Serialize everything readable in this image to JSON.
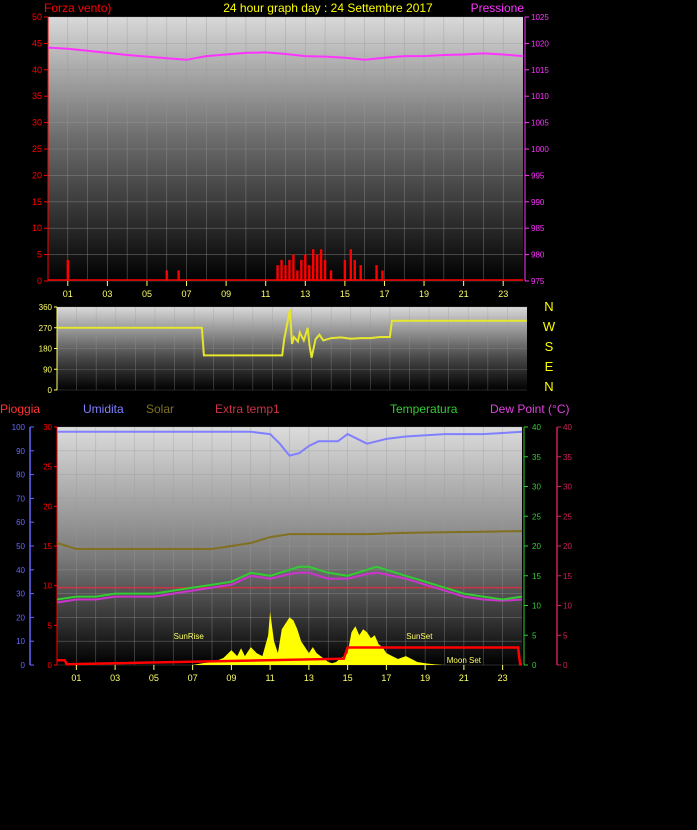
{
  "header": {
    "left_label": "Forza vento)",
    "center_title": "24 hour graph day : 24 Settembre 2017",
    "right_label": "Pressione"
  },
  "colors": {
    "wind": "#ff0000",
    "pressure": "#ff33ff",
    "direction": "#e6e62e",
    "humidity": "#8080ff",
    "solar": "#807020",
    "extra_temp": "#cc3344",
    "temperature": "#33cc33",
    "dew_point": "#cc33cc",
    "rain": "#ff0000",
    "solar_fill": "#ffff00",
    "pioggia_label": "#ff3333",
    "axis_blue": "#6666ff",
    "axis_green": "#33cc33",
    "axis_pink": "#cc2255",
    "tick_yellow": "#ffff66"
  },
  "x_ticks": [
    "01",
    "03",
    "05",
    "07",
    "09",
    "11",
    "13",
    "15",
    "17",
    "19",
    "21",
    "23"
  ],
  "chart_data": [
    {
      "type": "bar",
      "title": "24 hour graph day : 24 Settembre 2017",
      "ylabel": "Forza vento)",
      "y2label": "Pressione",
      "ylim": [
        0,
        50
      ],
      "y2lim": [
        975,
        1025
      ],
      "yticks": [
        0,
        5,
        10,
        15,
        20,
        25,
        30,
        35,
        40,
        45,
        50
      ],
      "y2ticks": [
        975,
        980,
        985,
        990,
        995,
        1000,
        1005,
        1010,
        1015,
        1020,
        1025
      ],
      "series": [
        {
          "name": "Forza vento)",
          "kind": "bar",
          "axis": "left",
          "x": [
            1.0,
            6.0,
            6.6,
            11.6,
            11.8,
            12.0,
            12.2,
            12.4,
            12.6,
            12.8,
            13.0,
            13.2,
            13.4,
            13.6,
            13.8,
            14.0,
            14.3,
            15.0,
            15.3,
            15.5,
            15.8,
            16.6,
            16.9
          ],
          "values": [
            4,
            2,
            2,
            3,
            4,
            3,
            4,
            5,
            2,
            4,
            5,
            3,
            6,
            5,
            6,
            4,
            2,
            4,
            6,
            4,
            3,
            3,
            2
          ]
        },
        {
          "name": "Pressione",
          "kind": "line",
          "axis": "right",
          "x": [
            0,
            1,
            2,
            3,
            4,
            5,
            6,
            7,
            8,
            9,
            10,
            11,
            12,
            13,
            14,
            15,
            16,
            17,
            18,
            19,
            20,
            21,
            22,
            23,
            24
          ],
          "values": [
            1019.2,
            1019.0,
            1018.6,
            1018.2,
            1017.8,
            1017.5,
            1017.2,
            1016.9,
            1017.6,
            1017.9,
            1018.2,
            1018.3,
            1018.0,
            1017.6,
            1017.5,
            1017.3,
            1016.9,
            1017.3,
            1017.6,
            1017.6,
            1017.8,
            1017.9,
            1018.1,
            1017.9,
            1017.6
          ]
        }
      ]
    },
    {
      "type": "line",
      "ylim": [
        0,
        360
      ],
      "yticks": [
        0,
        90,
        180,
        270,
        360
      ],
      "direction_labels": [
        "N",
        "W",
        "S",
        "E",
        "N"
      ],
      "series": [
        {
          "name": "direction",
          "x": [
            0,
            7.4,
            7.5,
            11.5,
            11.6,
            11.9,
            12.0,
            12.1,
            12.3,
            12.4,
            12.6,
            12.8,
            12.9,
            13.0,
            13.2,
            13.4,
            13.6,
            14.0,
            14.5,
            15.0,
            15.5,
            16.0,
            16.5,
            17.0,
            17.1,
            24
          ],
          "values": [
            270,
            270,
            150,
            150,
            220,
            350,
            200,
            230,
            210,
            250,
            215,
            270,
            190,
            140,
            220,
            240,
            215,
            225,
            228,
            222,
            225,
            225,
            230,
            230,
            300,
            300
          ]
        }
      ]
    },
    {
      "type": "line",
      "legend": [
        "Pioggia",
        "Umidita",
        "Solar",
        "Extra temp1",
        "Temperatura",
        "Dew Point (°C)"
      ],
      "left_axis": {
        "label": "Umidita",
        "ylim": [
          0,
          100
        ],
        "yticks": [
          0,
          10,
          20,
          30,
          40,
          50,
          60,
          70,
          80,
          90,
          100
        ]
      },
      "left_axis2": {
        "label": "Pioggia",
        "ylim": [
          0,
          30
        ],
        "yticks": [
          0,
          5,
          10,
          15,
          20,
          25,
          30
        ]
      },
      "right_axis": {
        "label": "Temperatura",
        "ylim": [
          0,
          40
        ],
        "yticks": [
          0,
          5,
          10,
          15,
          20,
          25,
          30,
          35,
          40
        ]
      },
      "right_axis2": {
        "label": "Dew Point (°C)",
        "ylim": [
          0,
          40
        ],
        "yticks": [
          0,
          5,
          10,
          15,
          20,
          25,
          30,
          35,
          40
        ]
      },
      "annotations": [
        {
          "text": "SunRise",
          "x": 6.8
        },
        {
          "text": "SunSet",
          "x": 18.7
        },
        {
          "text": "Moon Set",
          "x": 21.0
        }
      ],
      "series": [
        {
          "name": "Umidita",
          "axis": "left",
          "x": [
            0,
            2,
            4,
            6,
            8,
            10,
            11,
            11.5,
            12,
            12.5,
            13,
            13.5,
            14,
            14.5,
            15,
            16,
            17,
            18,
            20,
            22,
            24
          ],
          "values": [
            98,
            98,
            98,
            98,
            98,
            98,
            97,
            93,
            88,
            89,
            92,
            94,
            94,
            94,
            97,
            93,
            95,
            96,
            97,
            97,
            98
          ]
        },
        {
          "name": "Solar",
          "axis": "right",
          "x": [
            0,
            1,
            2,
            4,
            6,
            8,
            10,
            11,
            12,
            14,
            16,
            18,
            20,
            22,
            24
          ],
          "values": [
            20.5,
            19.5,
            19.5,
            19.5,
            19.5,
            19.5,
            20.5,
            21.5,
            22,
            22,
            22,
            22.2,
            22.3,
            22.4,
            22.5
          ]
        },
        {
          "name": "Extra temp1",
          "axis": "right",
          "x": [
            0,
            24
          ],
          "values": [
            13,
            13
          ]
        },
        {
          "name": "Temperatura",
          "axis": "right",
          "x": [
            0,
            1,
            2,
            3,
            4,
            5,
            6,
            7,
            8,
            9,
            10,
            11,
            12,
            12.5,
            13,
            13.5,
            14,
            15,
            16,
            16.5,
            17,
            18,
            19,
            20,
            21,
            22,
            23,
            24
          ],
          "values": [
            11,
            11.5,
            11.5,
            12,
            12,
            12,
            12.5,
            13,
            13.5,
            14,
            15.5,
            15,
            16,
            16.5,
            16.5,
            16,
            15.5,
            15,
            16,
            16.5,
            16,
            15,
            14,
            13,
            12,
            11.5,
            11,
            11.5
          ]
        },
        {
          "name": "Dew Point (°C)",
          "axis": "right",
          "x": [
            0,
            1,
            2,
            3,
            4,
            5,
            6,
            7,
            8,
            9,
            10,
            11,
            12,
            12.5,
            13,
            13.5,
            14,
            15,
            16,
            16.5,
            17,
            18,
            19,
            20,
            21,
            22,
            23,
            24
          ],
          "values": [
            10.5,
            11,
            11,
            11.5,
            11.5,
            11.5,
            12,
            12.5,
            13,
            13.5,
            15,
            14.5,
            15.3,
            15.5,
            15.5,
            15,
            14.5,
            14.5,
            15.3,
            15.5,
            15.2,
            14.5,
            13.5,
            12.5,
            11.5,
            11,
            10.8,
            11
          ]
        },
        {
          "name": "Pioggia",
          "axis": "left2",
          "x": [
            0,
            0.4,
            0.5,
            14.8,
            15.0,
            23.8,
            23.9,
            24
          ],
          "values": [
            0.6,
            0.6,
            0.1,
            0.8,
            2.2,
            2.2,
            0.1,
            0.1
          ]
        },
        {
          "name": "Solar radiation",
          "kind": "area",
          "axis": "right",
          "x": [
            7.0,
            7.5,
            8.0,
            8.3,
            8.6,
            9.0,
            9.3,
            9.5,
            9.7,
            10.0,
            10.3,
            10.6,
            10.9,
            11.0,
            11.2,
            11.4,
            11.6,
            11.8,
            12.0,
            12.2,
            12.4,
            12.6,
            12.8,
            13.0,
            13.2,
            13.4,
            13.6,
            13.8,
            14.0,
            14.2,
            14.4,
            14.6,
            14.8,
            15.0,
            15.2,
            15.4,
            15.6,
            15.8,
            16.0,
            16.2,
            16.4,
            16.6,
            16.8,
            17.0,
            17.3,
            17.6,
            18.0,
            18.3,
            18.6,
            19.0,
            19.5,
            20.0
          ],
          "values": [
            0,
            0.3,
            0.5,
            0.8,
            1.2,
            2.5,
            1.5,
            2.8,
            1.5,
            3,
            2,
            1.5,
            5,
            9,
            4,
            2,
            6,
            7,
            8,
            7.5,
            6,
            4,
            3,
            2,
            3,
            2,
            1.5,
            1,
            0.5,
            0.3,
            0.5,
            1,
            1.5,
            2,
            5.5,
            6.5,
            5,
            6,
            5.5,
            4.5,
            5,
            3.5,
            3,
            2,
            1.5,
            1,
            1.5,
            1,
            0.5,
            0.3,
            0.1,
            0
          ]
        }
      ]
    }
  ]
}
